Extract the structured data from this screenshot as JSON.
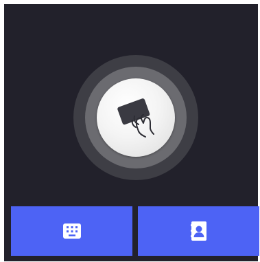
{
  "screen": {
    "background": "#22212b"
  },
  "reader": {
    "icon": "card-in-hand-icon",
    "ring_outer_color": "#3e3e45",
    "ring_middle_color": "#6b6b70"
  },
  "buttons": [
    {
      "icon": "keypad-icon",
      "color": "#4d63f5"
    },
    {
      "icon": "contacts-book-icon",
      "color": "#4d63f5"
    }
  ]
}
